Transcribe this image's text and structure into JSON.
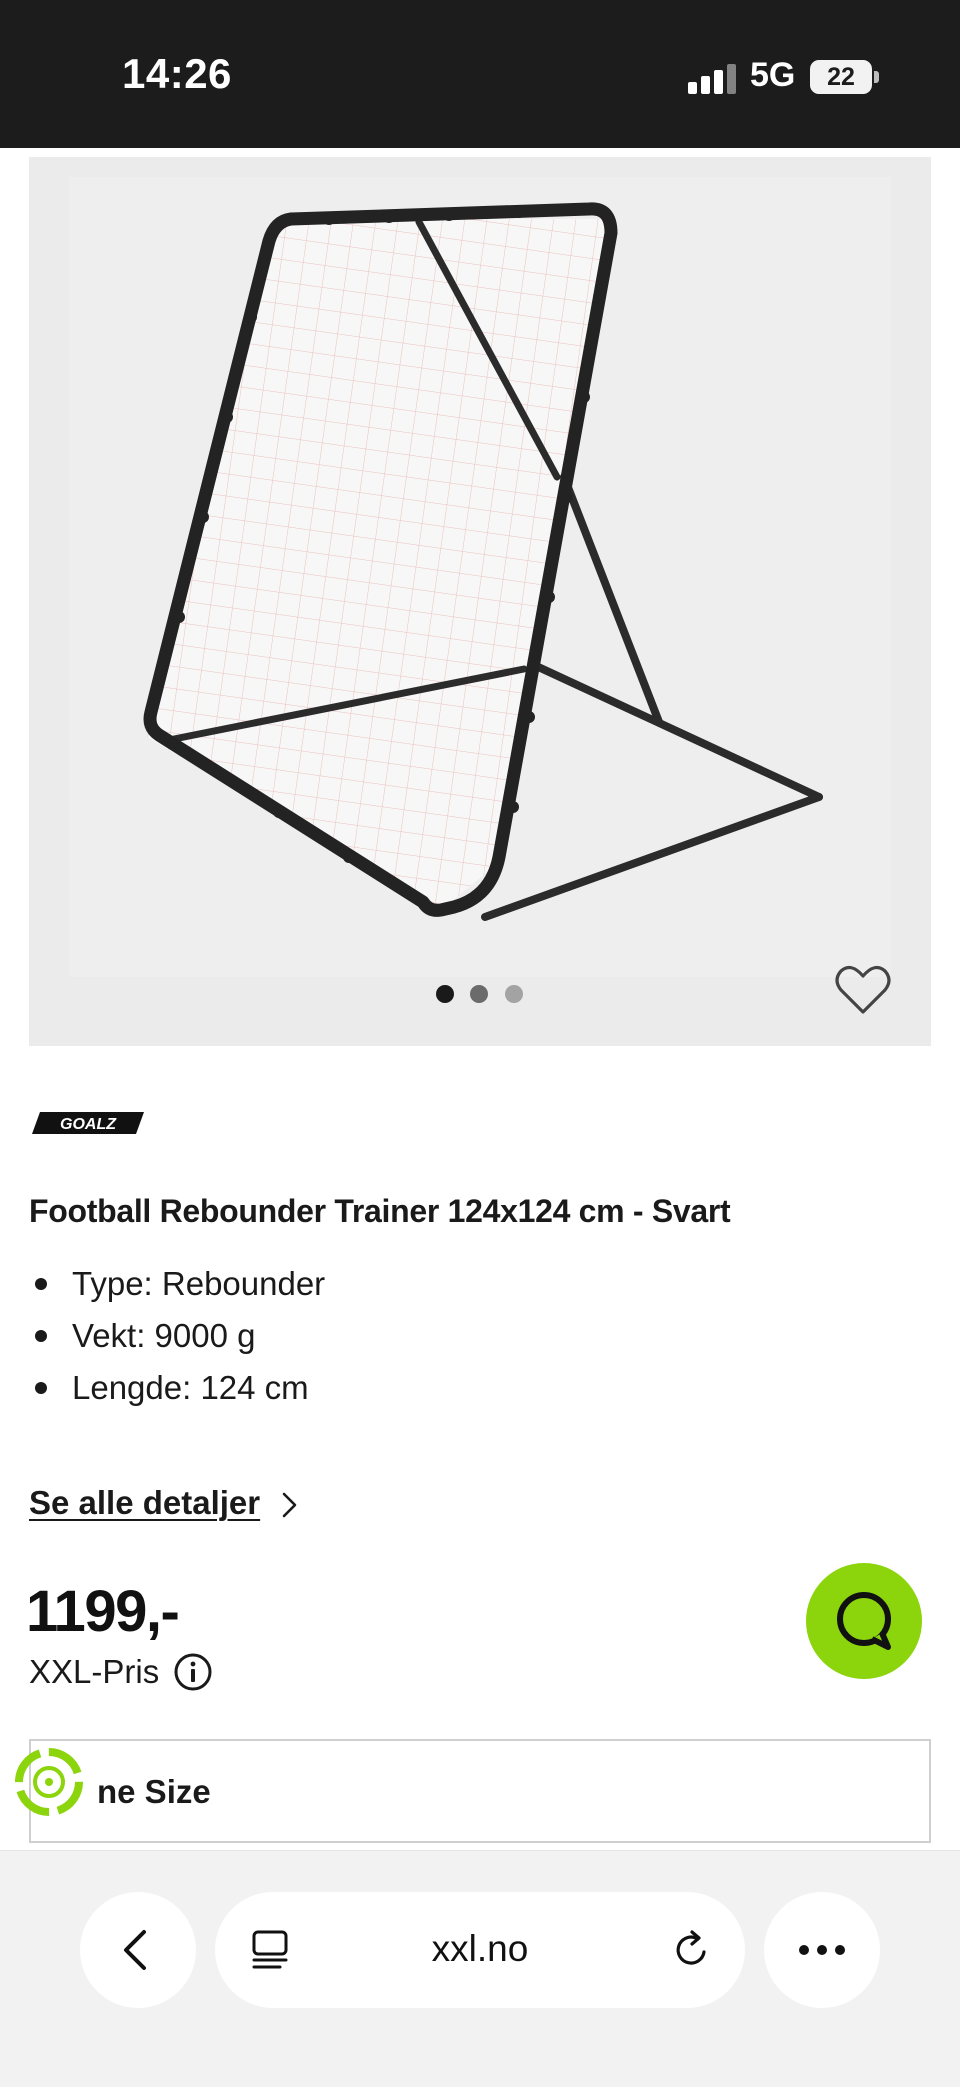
{
  "status_bar": {
    "time": "14:26",
    "network": "5G",
    "battery": "22"
  },
  "product": {
    "image_alt_icon": "football-rebounder-net",
    "carousel": {
      "total": 3,
      "active": 1
    },
    "brand": "GOALZ",
    "title": "Football Rebounder Trainer 124x124 cm - Svart",
    "specs": [
      "Type: Rebounder",
      "Vekt: 9000 g",
      "Lengde: 124 cm"
    ],
    "details_link": "Se alle detaljer",
    "price": "1199,-",
    "price_label": "XXL-Pris",
    "size_select_value": "ne Size"
  },
  "browser": {
    "url": "xxl.no"
  },
  "colors": {
    "status_bar_bg": "#1c1c1c",
    "chat_accent": "#8cd40c",
    "image_bg": "#ebebeb",
    "net_color": "#c2452f"
  },
  "icons": {
    "favorite": "heart-icon",
    "chat": "chat-bubble-icon",
    "info": "info-icon",
    "chevron": "chevron-right-icon",
    "back": "chevron-left-icon",
    "tabs": "tabs-icon",
    "reload": "reload-icon",
    "more": "more-icon"
  }
}
